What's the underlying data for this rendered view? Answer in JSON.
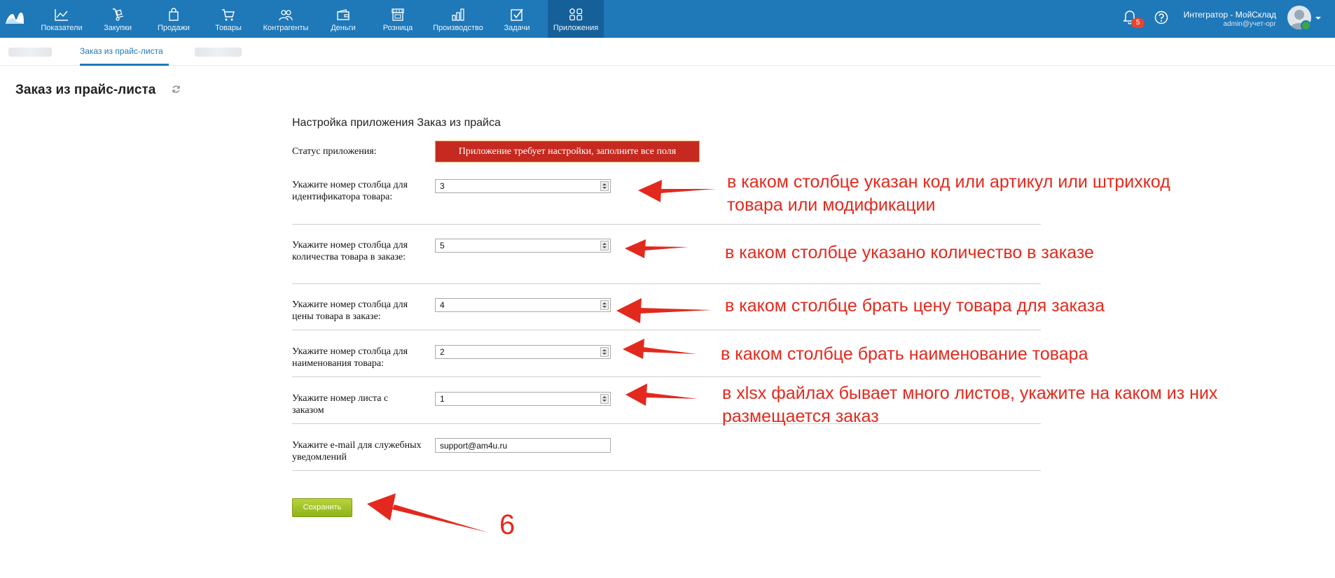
{
  "topbar": {
    "color": "#1f78b8",
    "nav": [
      {
        "label": "Показатели",
        "icon": "chart-line-icon"
      },
      {
        "label": "Закупки",
        "icon": "hand-truck-icon"
      },
      {
        "label": "Продажи",
        "icon": "shopping-bag-icon"
      },
      {
        "label": "Товары",
        "icon": "cart-icon"
      },
      {
        "label": "Контрагенты",
        "icon": "contacts-icon"
      },
      {
        "label": "Деньги",
        "icon": "wallet-icon"
      },
      {
        "label": "Розница",
        "icon": "store-icon"
      },
      {
        "label": "Производство",
        "icon": "production-chart-icon"
      },
      {
        "label": "Задачи",
        "icon": "task-check-icon"
      },
      {
        "label": "Приложения",
        "icon": "apps-grid-icon",
        "active": true
      }
    ],
    "notifications_count": "5",
    "user_name": "Интегратор - МойСклад",
    "user_email": "admin@учет-орг"
  },
  "subtabs": {
    "active_label": "Заказ из прайс-листа"
  },
  "page": {
    "title": "Заказ из прайс-листа"
  },
  "form": {
    "title": "Настройка приложения Заказ из прайса",
    "status_label": "Статус приложения:",
    "status_value": "Приложение требует настройки, заполните все поля",
    "fields": [
      {
        "label": "Укажите номер столбца для идентификатора товара:",
        "value": "3"
      },
      {
        "label": "Укажите номер столбца для количества товара в заказе:",
        "value": "5"
      },
      {
        "label": "Укажите номер столбца для цены товара в заказе:",
        "value": "4"
      },
      {
        "label": "Укажите номер столбца для наименования товара:",
        "value": "2"
      },
      {
        "label": "Укажите номер листа с заказом",
        "value": "1"
      },
      {
        "label": "Укажите e-mail для служебных уведомлений",
        "value": "support@am4u.ru"
      }
    ],
    "save_label": "Сохранить",
    "save_color": "#9bbf24",
    "status_color": "#c5291f"
  },
  "annotations": {
    "color": "#e3291d",
    "notes": [
      {
        "line1": "в каком столбце указан код или артикул или штрихкод",
        "line2": "товара или модификации"
      },
      {
        "line1": "в каком столбце указано количество в заказе"
      },
      {
        "line1": "в каком столбце брать цену товара для заказа"
      },
      {
        "line1": "в каком столбце брать наименование товара"
      },
      {
        "line1": "в xlsx файлах бывает много листов, укажите на каком из них",
        "line2": "размещается заказ"
      }
    ],
    "number": "6"
  }
}
